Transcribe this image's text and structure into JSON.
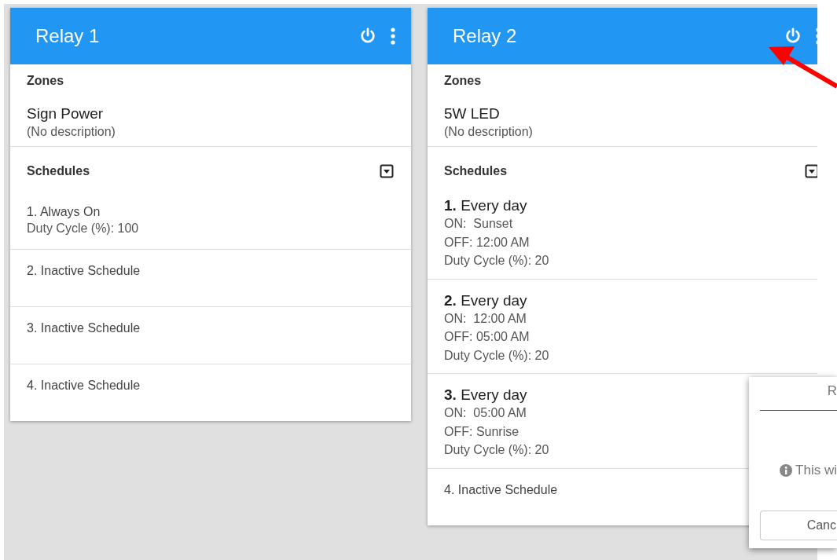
{
  "relays": [
    {
      "title": "Relay 1",
      "zones_label": "Zones",
      "zone_name": "Sign Power",
      "zone_description": "(No description)",
      "schedules_label": "Schedules",
      "schedules": [
        {
          "kind": "basic",
          "title": "1. Always On",
          "lines": [
            "Duty Cycle (%): 100"
          ]
        },
        {
          "kind": "inactive",
          "title": "2. Inactive Schedule"
        },
        {
          "kind": "inactive",
          "title": "3. Inactive Schedule"
        },
        {
          "kind": "inactive",
          "title": "4. Inactive Schedule"
        }
      ]
    },
    {
      "title": "Relay 2",
      "zones_label": "Zones",
      "zone_name": "5W LED",
      "zone_description": "(No description)",
      "schedules_label": "Schedules",
      "schedules": [
        {
          "kind": "active",
          "title": "**1.** Every day",
          "lines": [
            "ON:  Sunset",
            "OFF: 12:00 AM",
            "Duty Cycle (%): 20"
          ]
        },
        {
          "kind": "active",
          "title": "**2.** Every day",
          "lines": [
            "ON:  12:00 AM",
            "OFF: 05:00 AM",
            "Duty Cycle (%): 20"
          ]
        },
        {
          "kind": "active",
          "title": "**3.** Every day",
          "lines": [
            "ON:  05:00 AM",
            "OFF: Sunrise",
            "Duty Cycle (%): 20"
          ]
        },
        {
          "kind": "inactive",
          "title": "4. Inactive Schedule"
        }
      ]
    }
  ],
  "dialog": {
    "title": "R",
    "message": "This wi",
    "cancel_button": "Canc"
  }
}
